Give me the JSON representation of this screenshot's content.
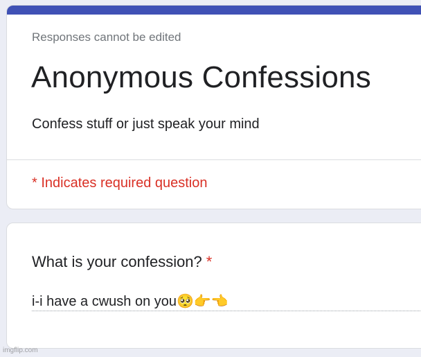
{
  "colors": {
    "accent": "#3f51b5",
    "required": "#d93025"
  },
  "form": {
    "notice": "Responses cannot be edited",
    "title": "Anonymous Confessions",
    "description": "Confess stuff or just speak your mind",
    "required_note": "* Indicates required question"
  },
  "question": {
    "label": "What is your confession?",
    "required_mark": "*",
    "answer_value": "i-i have a cwush on you🥺👉👈"
  },
  "watermark": "imgflip.com"
}
